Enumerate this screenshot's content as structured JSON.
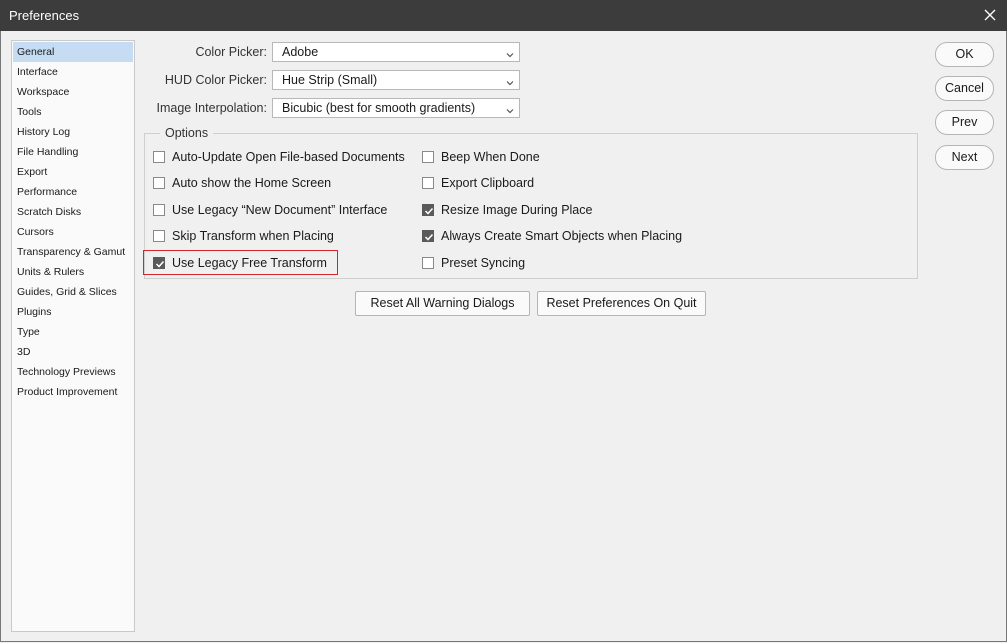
{
  "window": {
    "title": "Preferences"
  },
  "sidebar": {
    "items": [
      {
        "label": "General",
        "selected": true
      },
      {
        "label": "Interface"
      },
      {
        "label": "Workspace"
      },
      {
        "label": "Tools"
      },
      {
        "label": "History Log"
      },
      {
        "label": "File Handling"
      },
      {
        "label": "Export"
      },
      {
        "label": "Performance"
      },
      {
        "label": "Scratch Disks"
      },
      {
        "label": "Cursors"
      },
      {
        "label": "Transparency & Gamut"
      },
      {
        "label": "Units & Rulers"
      },
      {
        "label": "Guides, Grid & Slices"
      },
      {
        "label": "Plugins"
      },
      {
        "label": "Type"
      },
      {
        "label": "3D"
      },
      {
        "label": "Technology Previews"
      },
      {
        "label": "Product Improvement"
      }
    ]
  },
  "fields": {
    "color_picker": {
      "label": "Color Picker:",
      "value": "Adobe"
    },
    "hud_color_picker": {
      "label": "HUD Color Picker:",
      "value": "Hue Strip (Small)"
    },
    "image_interpolation": {
      "label": "Image Interpolation:",
      "value": "Bicubic (best for smooth gradients)"
    }
  },
  "options": {
    "legend": "Options",
    "left": [
      {
        "label": "Auto-Update Open File-based Documents",
        "checked": false
      },
      {
        "label": "Auto show the Home Screen",
        "checked": false
      },
      {
        "label": "Use Legacy “New Document” Interface",
        "checked": false
      },
      {
        "label": "Skip Transform when Placing",
        "checked": false
      },
      {
        "label": "Use Legacy Free Transform",
        "checked": true
      }
    ],
    "right": [
      {
        "label": "Beep When Done",
        "checked": false
      },
      {
        "label": "Export Clipboard",
        "checked": false
      },
      {
        "label": "Resize Image During Place",
        "checked": true
      },
      {
        "label": "Always Create Smart Objects when Placing",
        "checked": true
      },
      {
        "label": "Preset Syncing",
        "checked": false
      }
    ]
  },
  "actions": {
    "reset_warnings": "Reset All Warning Dialogs",
    "reset_prefs": "Reset Preferences On Quit"
  },
  "dialog_buttons": {
    "ok": "OK",
    "cancel": "Cancel",
    "prev": "Prev",
    "next": "Next"
  },
  "colors": {
    "titlebar": "#3c3c3c",
    "selected_item": "#c6dcf3",
    "highlight": "#d6242b",
    "checkbox_checked": "#5a5a5a"
  }
}
